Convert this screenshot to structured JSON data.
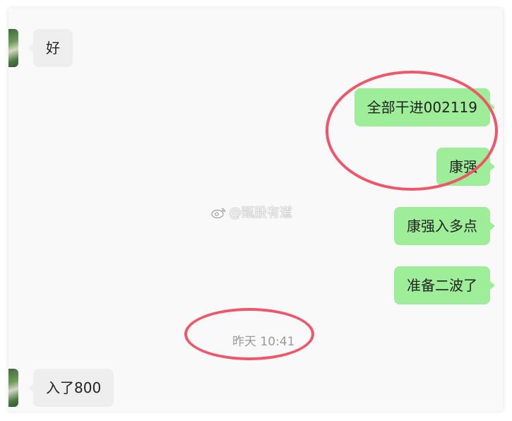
{
  "messages": [
    {
      "side": "left",
      "text": "好"
    },
    {
      "side": "right",
      "text": "全部干进002119"
    },
    {
      "side": "right",
      "text": "康强"
    },
    {
      "side": "right",
      "text": "康强入多点"
    },
    {
      "side": "right",
      "text": "准备二波了"
    },
    {
      "side": "left",
      "text": "入了800"
    }
  ],
  "timestamp": "昨天 10:41",
  "watermark": "@甄股有道",
  "colors": {
    "sent_bubble": "#9eee99",
    "received_bubble": "#eeeeee",
    "annotation": "#f0566a",
    "background": "#f9f9f9"
  }
}
